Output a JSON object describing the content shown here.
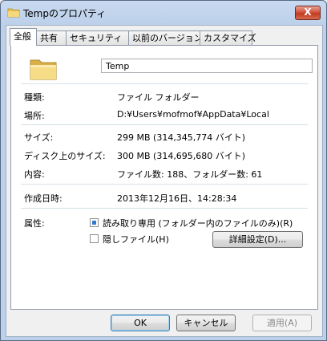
{
  "window": {
    "title": "Tempのプロパティ",
    "close_label": "X"
  },
  "tabs": [
    {
      "label": "全般",
      "active": true
    },
    {
      "label": "共有",
      "active": false
    },
    {
      "label": "セキュリティ",
      "active": false
    },
    {
      "label": "以前のバージョン",
      "active": false
    },
    {
      "label": "カスタマイズ",
      "active": false
    }
  ],
  "general": {
    "name_value": "Temp",
    "type": {
      "label": "種類:",
      "value": "ファイル フォルダー"
    },
    "location": {
      "label": "場所:",
      "value": "D:¥Users¥mofmof¥AppData¥Local"
    },
    "size": {
      "label": "サイズ:",
      "value": "299 MB (314,345,774 バイト)"
    },
    "size_on_disk": {
      "label": "ディスク上のサイズ:",
      "value": "300 MB (314,695,680 バイト)"
    },
    "contents": {
      "label": "内容:",
      "value": "ファイル数: 188、フォルダー数: 61"
    },
    "created": {
      "label": "作成日時:",
      "value": "2013年12月16日、14:28:34"
    },
    "attributes": {
      "label": "属性:",
      "readonly_label": "読み取り専用 (フォルダー内のファイルのみ)(R)",
      "hidden_label": "隠しファイル(H)",
      "advanced_button": "詳細設定(D)..."
    }
  },
  "buttons": {
    "ok": "OK",
    "cancel": "キャンセル",
    "apply": "適用(A)"
  },
  "colors": {
    "accent": "#2f7bd1",
    "title_bg": "#bcd0ea",
    "close": "#c23b20"
  },
  "icons": {
    "title": "folder-icon",
    "large": "folder-icon"
  }
}
